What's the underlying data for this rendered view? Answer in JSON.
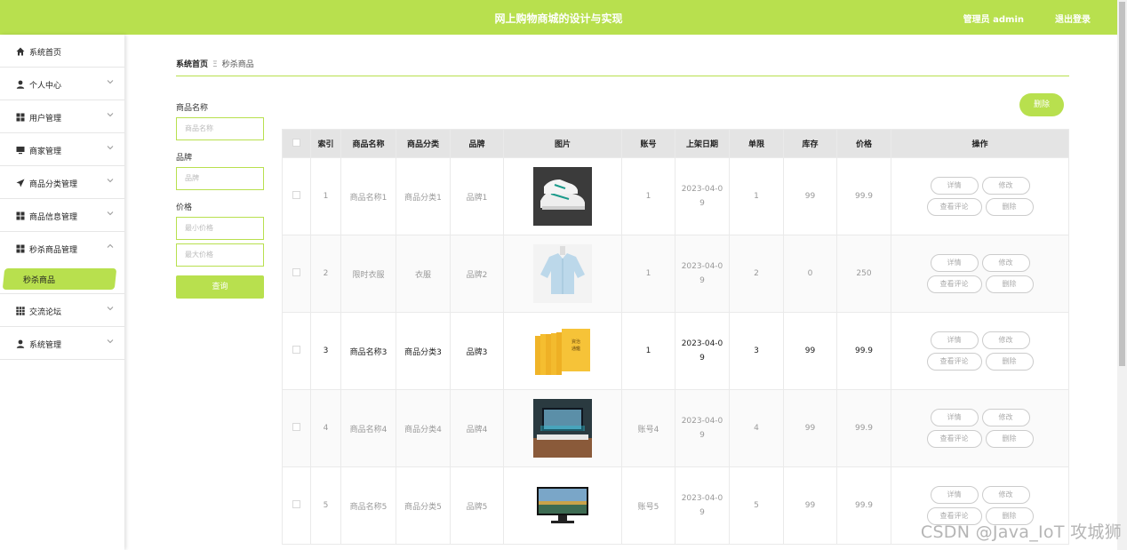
{
  "header": {
    "title": "网上购物商城的设计与实现",
    "admin_label": "管理员 admin",
    "logout_label": "退出登录"
  },
  "sidebar": {
    "items": [
      {
        "label": "系统首页",
        "icon": "home-icon"
      },
      {
        "label": "个人中心",
        "icon": "user-icon"
      },
      {
        "label": "用户管理",
        "icon": "grid-icon"
      },
      {
        "label": "商家管理",
        "icon": "monitor-icon"
      },
      {
        "label": "商品分类管理",
        "icon": "send-icon"
      },
      {
        "label": "商品信息管理",
        "icon": "grid-icon"
      },
      {
        "label": "秒杀商品管理",
        "icon": "grid-icon"
      },
      {
        "label": "交流论坛",
        "icon": "apps-icon"
      },
      {
        "label": "系统管理",
        "icon": "user-icon"
      }
    ],
    "active_sub": "秒杀商品"
  },
  "breadcrumb": {
    "home": "系统首页",
    "separator": "Ξ",
    "current": "秒杀商品"
  },
  "filters": {
    "name_label": "商品名称",
    "name_placeholder": "商品名称",
    "brand_label": "品牌",
    "brand_placeholder": "品牌",
    "price_label": "价格",
    "min_placeholder": "最小价格",
    "max_placeholder": "最大价格",
    "search_label": "查询"
  },
  "toolbar": {
    "delete_label": "删除"
  },
  "table": {
    "headers": [
      "",
      "索引",
      "商品名称",
      "商品分类",
      "品牌",
      "图片",
      "账号",
      "上架日期",
      "单限",
      "库存",
      "价格",
      "操作"
    ],
    "rows": [
      {
        "index": "1",
        "name": "商品名称1",
        "category": "商品分类1",
        "brand": "品牌1",
        "image": "sneaker",
        "account": "1",
        "date": "2023-04-09",
        "limit": "1",
        "stock": "99",
        "price": "99.9"
      },
      {
        "index": "2",
        "name": "限时衣服",
        "category": "衣服",
        "brand": "品牌2",
        "image": "shirt",
        "account": "1",
        "date": "2023-04-09",
        "limit": "2",
        "stock": "0",
        "price": "250"
      },
      {
        "index": "3",
        "name": "商品名称3",
        "category": "商品分类3",
        "brand": "品牌3",
        "image": "books",
        "account": "1",
        "date": "2023-04-09",
        "limit": "3",
        "stock": "99",
        "price": "99.9"
      },
      {
        "index": "4",
        "name": "商品名称4",
        "category": "商品分类4",
        "brand": "品牌4",
        "image": "tv-room",
        "account": "账号4",
        "date": "2023-04-09",
        "limit": "4",
        "stock": "99",
        "price": "99.9"
      },
      {
        "index": "5",
        "name": "商品名称5",
        "category": "商品分类5",
        "brand": "品牌5",
        "image": "monitor",
        "account": "账号5",
        "date": "2023-04-09",
        "limit": "5",
        "stock": "99",
        "price": "99.9"
      }
    ],
    "actions": {
      "detail": "详情",
      "edit": "修改",
      "comments": "查看评论",
      "delete": "删除"
    }
  },
  "watermark": "CSDN @Java_IoT 攻城狮",
  "colors": {
    "accent": "#b8e04e"
  }
}
